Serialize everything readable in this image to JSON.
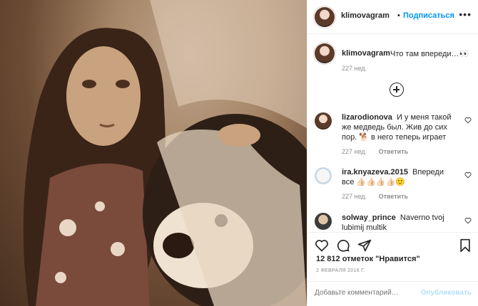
{
  "colors": {
    "accent": "#0095f6",
    "muted": "#8e8e8e",
    "text": "#262626",
    "post_disabled": "#b2dffc"
  },
  "header": {
    "username": "klimovagram",
    "dot": "•",
    "follow_label": "Подписаться",
    "more_icon": "more-dots-icon"
  },
  "caption": {
    "username": "klimovagram",
    "text": "Что там впереди…👀",
    "time": "227 нед."
  },
  "comments": [
    {
      "username": "lizarodionova",
      "text": "И у меня такой же медведь был. Жив до сих пор. 🐕 в него теперь играет",
      "time": "227 нед.",
      "reply": "Ответить"
    },
    {
      "username": "ira.knyazeva.2015",
      "text": "Впереди все 👍🏻👍🏻👍🏻👍🏻🙂",
      "time": "227 нед.",
      "reply": "Ответить"
    },
    {
      "username": "solway_prince",
      "text": "Naverno tvoj lubimij multik"
    }
  ],
  "post": {
    "likes": "12 812 отметок \"Нравится\"",
    "date": "2 ФЕВРАЛЯ 2016 Г."
  },
  "add_comment": {
    "placeholder": "Добавьте комментарий…",
    "post_label": "Опубликовать"
  }
}
